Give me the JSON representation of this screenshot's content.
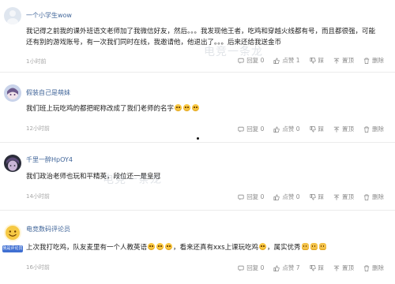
{
  "comments": [
    {
      "username": "一个小学生wow",
      "text_parts": [
        "我记得之前我的课外班语文老师加了我微信好友，然后。。。我发现他王者，吃鸡和穿越火线都有号，而且都很强，可能还有别的游戏账号，有一次我们同时在线，我邀请他，他退出了。。。后来还给我送金币"
      ],
      "time": "1小时前",
      "actions": {
        "reply": "回复 0",
        "like": "点赞 1",
        "dislike": "踩",
        "top": "置顶",
        "delete": "删除"
      }
    },
    {
      "username": "假装自己是萌妹",
      "text_parts": [
        "我们班上玩吃鸡的都把昵称改成了我们老师的名字"
      ],
      "emoji_count": 3,
      "time": "12小时前",
      "actions": {
        "reply": "回复 0",
        "like": "点赞 0",
        "dislike": "踩",
        "top": "置顶",
        "delete": "删除"
      }
    },
    {
      "username": "千里一醉HpOY4",
      "text_parts": [
        "我们政治老师也玩和平精英，段位还一是皇冠"
      ],
      "time": "14小时前",
      "actions": {
        "reply": "回复 0",
        "like": "点赞 0",
        "dislike": "踩",
        "top": "置顶",
        "delete": "删除"
      }
    },
    {
      "username": "电竞数码评论员",
      "badge": "我是评论员",
      "text_parts": [
        "上次我打吃鸡，队友麦里有一个人教英语",
        "，看来还真有xxs上课玩吃鸡",
        "，属实优秀"
      ],
      "time": "16小时前",
      "actions": {
        "reply": "回复 0",
        "like": "点赞 7",
        "dislike": "踩",
        "top": "置顶",
        "delete": "删除"
      }
    }
  ],
  "watermark": "电竞一条龙",
  "colors": {
    "username": "#406599",
    "time": "#a6a6a6",
    "action": "#8a8a8a",
    "badge": "#3f6fd2"
  }
}
